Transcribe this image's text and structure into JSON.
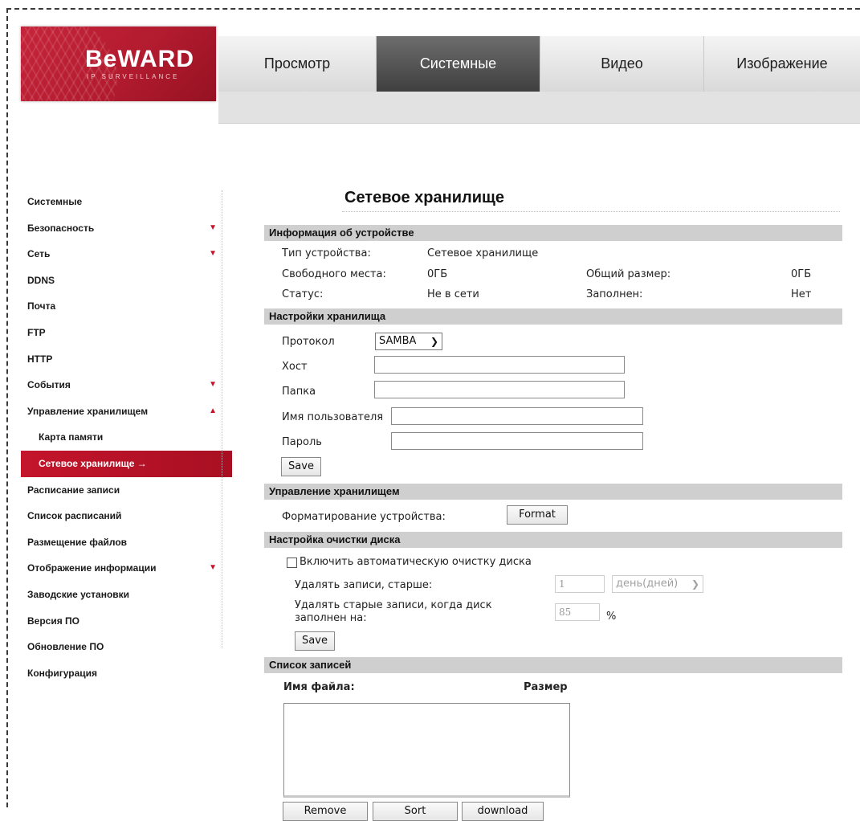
{
  "header": {
    "brand": "BeWARD",
    "brand_tagline": "IP SURVEILLANCE",
    "tabs": [
      "Просмотр",
      "Системные",
      "Видео",
      "Изображение"
    ],
    "active_tab": "Системные"
  },
  "sidebar": {
    "items": [
      {
        "label": "Системные"
      },
      {
        "label": "Безопасность",
        "arrow": "▼"
      },
      {
        "label": "Сеть",
        "arrow": "▼"
      },
      {
        "label": "DDNS"
      },
      {
        "label": "Почта"
      },
      {
        "label": "FTP"
      },
      {
        "label": "HTTP"
      },
      {
        "label": "События",
        "arrow": "▼"
      },
      {
        "label": "Управление хранилищем",
        "arrow": "▲"
      },
      {
        "label": "Карта памяти"
      },
      {
        "label": "Сетевое хранилище →"
      },
      {
        "label": "Расписание записи"
      },
      {
        "label": "Список расписаний"
      },
      {
        "label": "Размещение файлов"
      },
      {
        "label": "Отображение информации",
        "arrow": "▼"
      },
      {
        "label": "Заводские установки"
      },
      {
        "label": "Версия ПО"
      },
      {
        "label": "Обновление ПО"
      },
      {
        "label": "Конфигурация"
      }
    ]
  },
  "page": {
    "title": "Сетевое хранилище",
    "device_info": {
      "header": "Информация об устройстве",
      "type_label": "Тип устройства:",
      "type_value": "Сетевое хранилище",
      "free_label": "Свободного места:",
      "free_value": "0ГБ",
      "total_label": "Общий размер:",
      "total_value": "0ГБ",
      "status_label": "Статус:",
      "status_value": "Не в сети",
      "full_label": "Заполнен:",
      "full_value": "Нет"
    },
    "storage_settings": {
      "header": "Настройки хранилища",
      "protocol_label": "Протокол",
      "protocol_value": "SAMBA",
      "host_label": "Хост",
      "host_value": "",
      "folder_label": "Папка",
      "folder_value": "",
      "username_label": "Имя пользователя",
      "username_value": "",
      "password_label": "Пароль",
      "password_value": "",
      "save_label": "Save"
    },
    "storage_management": {
      "header": "Управление хранилищем",
      "format_label": "Форматирование устройства:",
      "format_button": "Format"
    },
    "disk_cleanup": {
      "header": "Настройка очистки диска",
      "enable_label": "Включить автоматическую очистку диска",
      "delete_older_label": "Удалять записи, старше:",
      "delete_older_value": "1",
      "delete_older_unit": "день(дней)",
      "delete_when_label_1": "Удалять старые записи, когда диск",
      "delete_when_label_2": "заполнен на:",
      "delete_when_value": "85",
      "percent": "%",
      "save_label": "Save"
    },
    "records": {
      "header": "Список записей",
      "col_filename": "Имя файла:",
      "col_size": "Размер",
      "remove_label": "Remove",
      "sort_label": "Sort",
      "download_label": "download"
    }
  }
}
